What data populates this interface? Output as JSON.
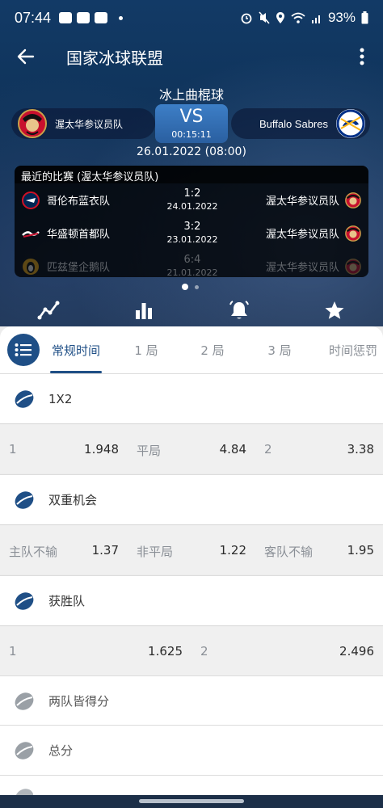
{
  "status": {
    "time": "07:44",
    "battery": "93%"
  },
  "appbar": {
    "title": "国家冰球联盟"
  },
  "match": {
    "sport": "冰上曲棍球",
    "vs": "VS",
    "clock": "00:15:11",
    "date": "26.01.2022 (08:00)",
    "home_team": "渥太华参议员队",
    "away_team": "Buffalo Sabres"
  },
  "recent": {
    "title": "最近的比赛 (渥太华参议员队)",
    "rows": [
      {
        "team": "哥伦布蓝衣队",
        "score": "1:2",
        "date": "24.01.2022",
        "opponent": "渥太华参议员队"
      },
      {
        "team": "华盛顿首都队",
        "score": "3:2",
        "date": "23.01.2022",
        "opponent": "渥太华参议员队"
      },
      {
        "team": "匹兹堡企鹅队",
        "score": "6:4",
        "date": "21.01.2022",
        "opponent": "渥太华参议员队"
      }
    ]
  },
  "tabs": [
    "常规时间",
    "1 局",
    "2 局",
    "3 局",
    "时间惩罚"
  ],
  "markets": {
    "m1x2": {
      "title": "1X2",
      "odds": [
        {
          "label": "1",
          "value": "1.948"
        },
        {
          "label": "平局",
          "value": "4.84"
        },
        {
          "label": "2",
          "value": "3.38"
        }
      ]
    },
    "double": {
      "title": "双重机会",
      "odds": [
        {
          "label": "主队不输",
          "value": "1.37"
        },
        {
          "label": "非平局",
          "value": "1.22"
        },
        {
          "label": "客队不输",
          "value": "1.95"
        }
      ]
    },
    "winner": {
      "title": "获胜队",
      "odds": [
        {
          "label": "1",
          "value": "1.625"
        },
        {
          "label": "2",
          "value": "2.496"
        }
      ]
    },
    "both_score": {
      "title": "两队皆得分"
    },
    "total": {
      "title": "总分"
    }
  },
  "colors": {
    "accent": "#1f4f86",
    "hero": "#123a66",
    "row_bg": "#f0f0f0"
  }
}
